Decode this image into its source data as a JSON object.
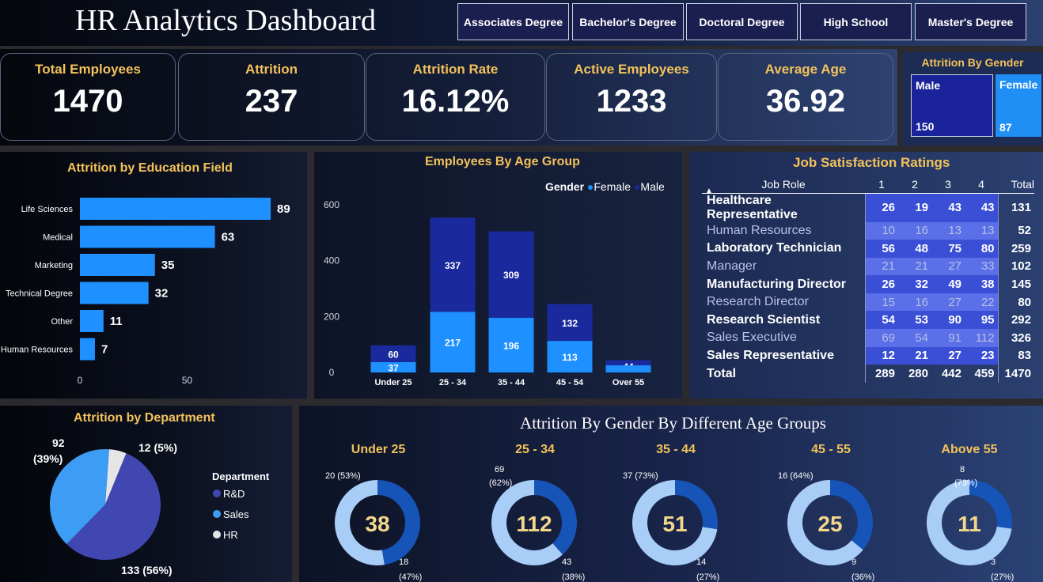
{
  "header": {
    "title": "HR Analytics Dashboard",
    "slicers": [
      "Associates Degree",
      "Bachelor's Degree",
      "Doctoral Degree",
      "High School",
      "Master's Degree"
    ]
  },
  "kpis": [
    {
      "label": "Total Employees",
      "value": "1470"
    },
    {
      "label": "Attrition",
      "value": "237"
    },
    {
      "label": "Attrition Rate",
      "value": "16.12%"
    },
    {
      "label": "Active Employees",
      "value": "1233"
    },
    {
      "label": "Average Age",
      "value": "36.92"
    }
  ],
  "gender_card": {
    "title": "Attrition By Gender",
    "male_label": "Male",
    "male_value": "150",
    "female_label": "Female",
    "female_value": "87",
    "colors": {
      "male": "#1a239a",
      "female": "#1f8ef5"
    }
  },
  "chart_data": [
    {
      "type": "bar",
      "title": "Attrition by Education Field",
      "orientation": "horizontal",
      "categories": [
        "Life Sciences",
        "Medical",
        "Marketing",
        "Technical Degree",
        "Other",
        "Human Resources"
      ],
      "values": [
        89,
        63,
        35,
        32,
        11,
        7
      ],
      "xticks": [
        0,
        50
      ],
      "xlim": [
        0,
        100
      ],
      "color": "#1e90ff"
    },
    {
      "type": "bar",
      "stacked": true,
      "title": "Employees By Age Group",
      "legend_title": "Gender",
      "legend_position": "top-right",
      "categories": [
        "Under 25",
        "25 - 34",
        "35 - 44",
        "45 - 54",
        "Over 55"
      ],
      "series": [
        {
          "name": "Female",
          "values": [
            37,
            217,
            196,
            113,
            null
          ],
          "color": "#1e90ff"
        },
        {
          "name": "Male",
          "values": [
            60,
            337,
            309,
            132,
            44
          ],
          "color": "#1a2a9c"
        }
      ],
      "yticks": [
        0,
        200,
        400,
        600
      ],
      "ylim": [
        0,
        600
      ]
    },
    {
      "type": "table",
      "title": "Job Satisfaction Ratings",
      "columns": [
        "Job Role",
        "1",
        "2",
        "3",
        "4",
        "Total"
      ],
      "rows": [
        [
          "Healthcare Representative",
          "26",
          "19",
          "43",
          "43",
          "131"
        ],
        [
          "Human Resources",
          "10",
          "16",
          "13",
          "13",
          "52"
        ],
        [
          "Laboratory Technician",
          "56",
          "48",
          "75",
          "80",
          "259"
        ],
        [
          "Manager",
          "21",
          "21",
          "27",
          "33",
          "102"
        ],
        [
          "Manufacturing Director",
          "26",
          "32",
          "49",
          "38",
          "145"
        ],
        [
          "Research Director",
          "15",
          "16",
          "27",
          "22",
          "80"
        ],
        [
          "Research Scientist",
          "54",
          "53",
          "90",
          "95",
          "292"
        ],
        [
          "Sales Executive",
          "69",
          "54",
          "91",
          "112",
          "326"
        ],
        [
          "Sales Representative",
          "12",
          "21",
          "27",
          "23",
          "83"
        ]
      ],
      "total_row": [
        "Total",
        "289",
        "280",
        "442",
        "459",
        "1470"
      ]
    },
    {
      "type": "pie",
      "title": "Attrition by Department",
      "legend_title": "Department",
      "slices": [
        {
          "name": "R&D",
          "value": 133,
          "label": "133 (56%)",
          "color": "#4047b0"
        },
        {
          "name": "Sales",
          "value": 92,
          "label": "92 (39%)",
          "color": "#3d9df5"
        },
        {
          "name": "HR",
          "value": 12,
          "label": "12 (5%)",
          "color": "#e6e6e6"
        }
      ]
    },
    {
      "type": "pie",
      "title": "Attrition By Gender By Different Age Groups",
      "subtype": "donut",
      "colors": {
        "light": "#a8cdf7",
        "dark": "#1654b8"
      },
      "groups": [
        {
          "name": "Under 25",
          "total": "38",
          "light": 20,
          "dark": 18,
          "light_label": "20 (53%)",
          "dark_label_1": "18",
          "dark_label_2": "(47%)"
        },
        {
          "name": "25 - 34",
          "total": "112",
          "light": 69,
          "dark": 43,
          "light_label_1": "69",
          "light_label_2": "(62%)",
          "dark_label_1": "43",
          "dark_label_2": "(38%)"
        },
        {
          "name": "35 - 44",
          "total": "51",
          "light": 37,
          "dark": 14,
          "light_label": "37 (73%)",
          "dark_label_1": "14",
          "dark_label_2": "(27%)"
        },
        {
          "name": "45 - 55",
          "total": "25",
          "light": 16,
          "dark": 9,
          "light_label": "16 (64%)",
          "dark_label_1": "9",
          "dark_label_2": "(36%)"
        },
        {
          "name": "Above 55",
          "total": "11",
          "light": 8,
          "dark": 3,
          "light_label_1": "8",
          "light_label_2": "(73%)",
          "dark_label_1": "3",
          "dark_label_2": "(27%)"
        }
      ]
    }
  ]
}
